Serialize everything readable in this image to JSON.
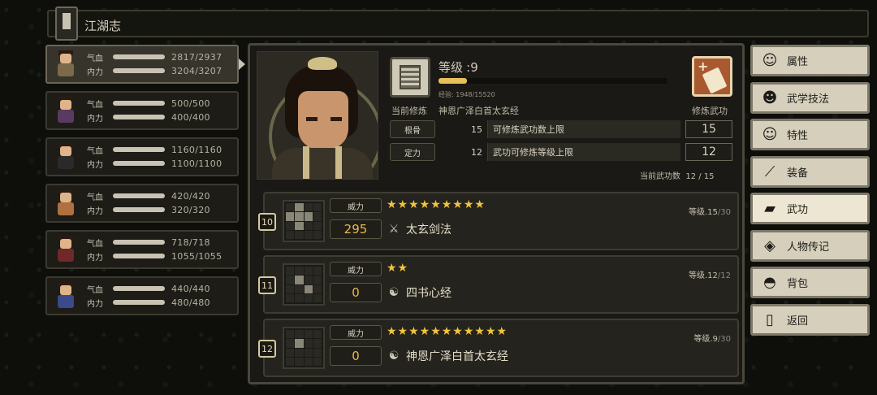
{
  "title": "江湖志",
  "characters": [
    {
      "hp_label": "气血",
      "hp": "2817/2937",
      "mp_label": "内力",
      "mp": "3204/3207",
      "robe": "#7a6a4a"
    },
    {
      "hp_label": "气血",
      "hp": "500/500",
      "mp_label": "内力",
      "mp": "400/400",
      "robe": "#5a3a60"
    },
    {
      "hp_label": "气血",
      "hp": "1160/1160",
      "mp_label": "内力",
      "mp": "1100/1100",
      "robe": "#2a2a2a"
    },
    {
      "hp_label": "气血",
      "hp": "420/420",
      "mp_label": "内力",
      "mp": "320/320",
      "robe": "#b07040"
    },
    {
      "hp_label": "气血",
      "hp": "718/718",
      "mp_label": "内力",
      "mp": "1055/1055",
      "robe": "#702828"
    },
    {
      "hp_label": "气血",
      "hp": "440/440",
      "mp_label": "内力",
      "mp": "480/480",
      "robe": "#3a4a8a"
    }
  ],
  "detail": {
    "level_label": "等级",
    "level_sep": ":",
    "level": "9",
    "exp_text": "经验: 1948/15520",
    "exp_fraction": 0.1255,
    "current_label": "当前修炼",
    "current_name": "神恩广泽白首太玄经",
    "practice_label": "修炼武功",
    "attrs": [
      {
        "name": "根骨",
        "value": "15",
        "desc": "可修炼武功数上限",
        "box": "15"
      },
      {
        "name": "定力",
        "value": "12",
        "desc": "武功可修炼等级上限",
        "box": "12"
      }
    ],
    "slot_label": "当前武功数",
    "slot_value": "12 / 15"
  },
  "skills": [
    {
      "num": "10",
      "power_label": "威力",
      "power": "295",
      "stars": "★★★★★★★★★",
      "icon": "⚔",
      "name": "太玄剑法",
      "lv_label": "等级.",
      "lv": "15",
      "lv_max": "/30"
    },
    {
      "num": "11",
      "power_label": "威力",
      "power": "0",
      "stars": "★★",
      "icon": "☯",
      "name": "四书心经",
      "lv_label": "等级.",
      "lv": "12",
      "lv_max": "/12"
    },
    {
      "num": "12",
      "power_label": "威力",
      "power": "0",
      "stars": "★★★★★★★★★★★",
      "icon": "☯",
      "name": "神恩广泽白首太玄经",
      "lv_label": "等级.",
      "lv": "9",
      "lv_max": "/30"
    }
  ],
  "menu": [
    {
      "label": "属性",
      "icon": "☺"
    },
    {
      "label": "武学技法",
      "icon": "☻"
    },
    {
      "label": "特性",
      "icon": "☺"
    },
    {
      "label": "装备",
      "icon": "⟋"
    },
    {
      "label": "武功",
      "icon": "▰"
    },
    {
      "label": "人物传记",
      "icon": "◈"
    },
    {
      "label": "背包",
      "icon": "◓"
    },
    {
      "label": "返回",
      "icon": "▯"
    }
  ]
}
